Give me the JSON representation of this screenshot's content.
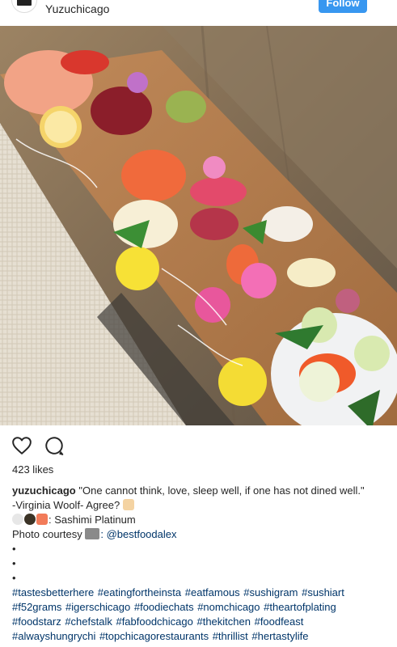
{
  "header": {
    "location": "Yuzuchicago",
    "follow_label": "Follow",
    "more_label": "•••"
  },
  "post": {
    "likes": "423 likes",
    "caption": {
      "username": "yuzuchicago",
      "quote_line1": "\"One cannot think, love, sleep well, if one has not dined well.\"",
      "quote_line2": "-Virginia Woolf- Agree?",
      "dish": ": Sashimi Platinum",
      "courtesy_prefix": "Photo courtesy",
      "courtesy_mention": ": @bestfoodalex",
      "dots": [
        "•",
        "•",
        "•"
      ],
      "hashtags_line1": "#tastesbetterhere #eatingfortheinsta #eatfamous #sushigram #sushiart",
      "hashtags_line2": "#f52grams #igerschicago #foodiechats #nomchicago #theartofplating",
      "hashtags_line3": "#foodstarz #chefstalk #fabfoodchicago #thekitchen #foodfeast",
      "hashtags_line4": "#alwayshungrychi #topchicagorestaurants #thrillist #hertastylife"
    }
  },
  "icons": {
    "like": "heart-icon",
    "comment": "comment-icon",
    "more": "more-icon"
  },
  "colors": {
    "follow_button": "#3897f0",
    "link": "#003569"
  }
}
